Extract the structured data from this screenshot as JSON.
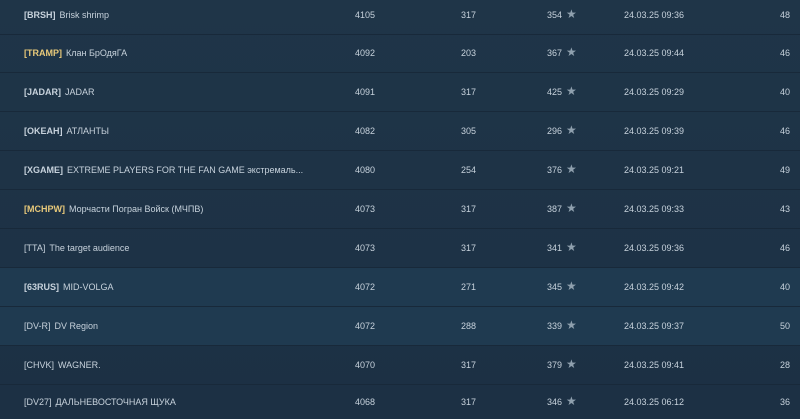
{
  "rows": [
    {
      "tag": "[BRSH]",
      "name": "Brisk shrimp",
      "rating": "4105",
      "battles": "317",
      "pos": "354",
      "date": "24.03.25 09:36",
      "members": "48"
    },
    {
      "tag": "[TRAMP]",
      "name": "Клан БрОдяГА",
      "rating": "4092",
      "battles": "203",
      "pos": "367",
      "date": "24.03.25 09:44",
      "members": "46"
    },
    {
      "tag": "[JADAR]",
      "name": "JADAR",
      "rating": "4091",
      "battles": "317",
      "pos": "425",
      "date": "24.03.25 09:29",
      "members": "40"
    },
    {
      "tag": "[OKEAH]",
      "name": "АТЛАНТЫ",
      "rating": "4082",
      "battles": "305",
      "pos": "296",
      "date": "24.03.25 09:39",
      "members": "46"
    },
    {
      "tag": "[XGAME]",
      "name": "EXTREME PLAYERS FOR THE FAN GAME экстремаль...",
      "rating": "4080",
      "battles": "254",
      "pos": "376",
      "date": "24.03.25 09:21",
      "members": "49"
    },
    {
      "tag": "[MCHPW]",
      "name": "Морчасти Погран Войск (МЧПВ)",
      "rating": "4073",
      "battles": "317",
      "pos": "387",
      "date": "24.03.25 09:33",
      "members": "43"
    },
    {
      "tag": "[TTA]",
      "name": "The target audience",
      "rating": "4073",
      "battles": "317",
      "pos": "341",
      "date": "24.03.25 09:36",
      "members": "46"
    },
    {
      "tag": "[63RUS]",
      "name": "MID-VOLGA",
      "rating": "4072",
      "battles": "271",
      "pos": "345",
      "date": "24.03.25 09:42",
      "members": "40"
    },
    {
      "tag": "[DV-R]",
      "name": "DV Region",
      "rating": "4072",
      "battles": "288",
      "pos": "339",
      "date": "24.03.25 09:37",
      "members": "50"
    },
    {
      "tag": "[CHVK]",
      "name": "WAGNER.",
      "rating": "4070",
      "battles": "317",
      "pos": "379",
      "date": "24.03.25 09:41",
      "members": "28"
    },
    {
      "tag": "[DV27]",
      "name": "ДАЛЬНЕВОСТОЧНАЯ ЩУКА",
      "rating": "4068",
      "battles": "317",
      "pos": "346",
      "date": "24.03.25 06:12",
      "members": "36"
    }
  ],
  "colors": {
    "background": "#1e3346",
    "text": "#c7d2dc",
    "gold_tag": "#e8c97a",
    "star": "#8fa0ae"
  },
  "icons": {
    "rank": "star-icon"
  }
}
